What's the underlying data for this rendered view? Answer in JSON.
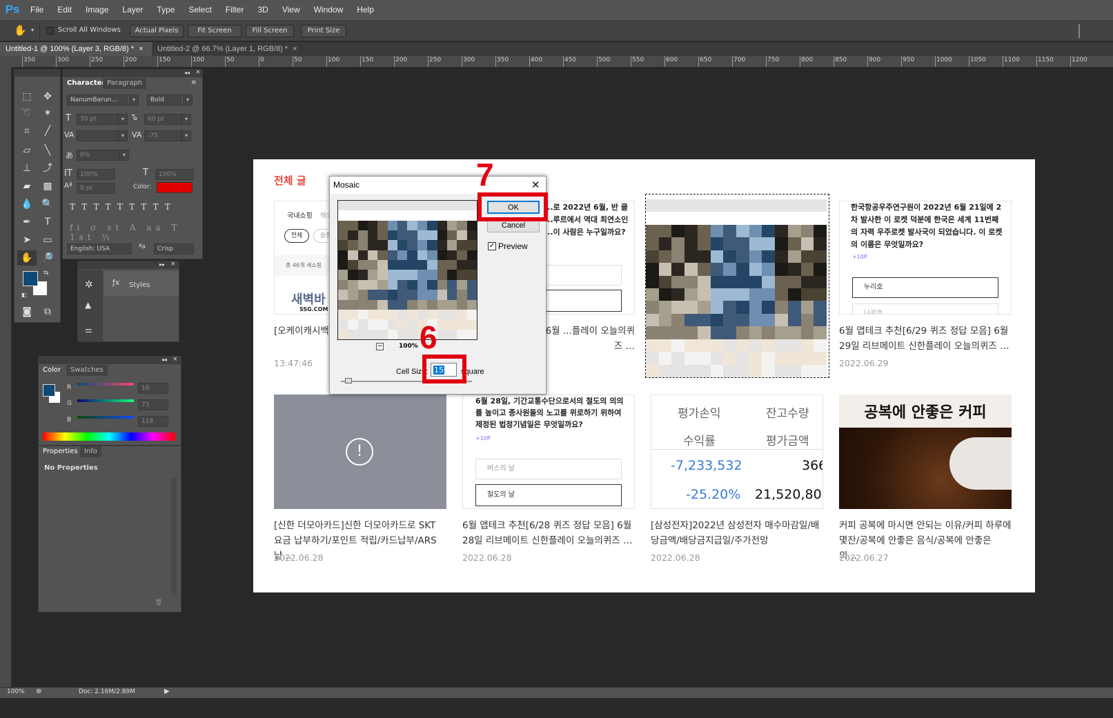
{
  "app": {
    "logo": "Ps"
  },
  "menu": [
    "File",
    "Edit",
    "Image",
    "Layer",
    "Type",
    "Select",
    "Filter",
    "3D",
    "View",
    "Window",
    "Help"
  ],
  "options": {
    "scroll_all": "Scroll All Windows",
    "actual_pixels": "Actual Pixels",
    "fit_screen": "Fit Screen",
    "fill_screen": "Fill Screen",
    "print_size": "Print Size"
  },
  "doc_tabs": [
    {
      "label": "Untitled-1 @ 100% (Layer 3, RGB/8) *",
      "active": true
    },
    {
      "label": "Untitled-2 @ 66.7% (Layer 1, RGB/8) *",
      "active": false
    }
  ],
  "ruler_labels": [
    "350",
    "300",
    "250",
    "200",
    "150",
    "100",
    "50",
    "0",
    "50",
    "100",
    "150",
    "200",
    "250",
    "300",
    "350",
    "400",
    "450",
    "500",
    "550",
    "600",
    "650",
    "700",
    "750",
    "800",
    "850",
    "900",
    "950",
    "1000",
    "1050",
    "1100",
    "1150",
    "1200"
  ],
  "character": {
    "tab_character": "Character",
    "tab_paragraph": "Paragraph",
    "font_family": "NanumBarun...",
    "font_style": "Bold",
    "size": "70 pt",
    "leading": "60 pt",
    "tracking": "-75",
    "scale_pct": "0%",
    "vscale": "100%",
    "hscale": "100%",
    "baseline": "0 pt",
    "color_label": "Color:",
    "color": "#e00000",
    "language": "English: USA",
    "aa_label": "ªa",
    "antialias": "Crisp"
  },
  "styles": {
    "label": "Styles"
  },
  "color_panel": {
    "tab_color": "Color",
    "tab_swatches": "Swatches",
    "r_label": "R",
    "g_label": "G",
    "b_label": "B",
    "r": "16",
    "g": "73",
    "b": "118",
    "fg": "#104976"
  },
  "properties": {
    "tab_properties": "Properties",
    "tab_info": "Info",
    "empty": "No Properties"
  },
  "status": {
    "zoom": "100%",
    "doc": "Doc: 2.16M/2.89M"
  },
  "blog": {
    "heading": "전체 글",
    "cards_row1": [
      {
        "title": "[오케이캐시백 ... 어플 쇼핑적립",
        "date": "13:47:46",
        "thumb_tab1": "국내쇼핑",
        "thumb_tab2": "해외",
        "pill1": "전체",
        "pill2": "숑핑",
        "count": "총 46개 새쇼핑",
        "brand": "새벽바",
        "brand2": "SSG.COM"
      },
      {
        "title": "...) 퀴즈 정답 모음] 6월 ...플레이 오늘의퀴즈 …",
        "quiz": "...로 2022년 6월, 반 클 ...루르에서 역대 최연소인 ...이 사람은 누구일까요?"
      },
      {
        "title": "",
        "date": ""
      },
      {
        "title": "6월 앱테크 추천[6/29 퀴즈 정답 모음] 6월 29일 리브메이트 신한플레이 오늘의퀴즈 …",
        "date": "2022.06.29",
        "quiz": "한국항공우주연구원이 2022년 6월 21일에 2차 발사한 이 로켓 덕분에 한국은 세계 11번째의 자력 우주로켓 발사국이 되었습니다. 이 로켓의 이름은 무엇일까요?",
        "hint": "+10P",
        "opt1": "누리호",
        "opt2": "나로호"
      }
    ],
    "cards_row2": [
      {
        "title": "[신한 더모아카드]신한 더모아카드로 SKT 요금 납부하기/포인트 적립/카드납부/ARS납…",
        "date": "2022.06.28",
        "icon": "!"
      },
      {
        "title": "6월 앱테크 추천[6/28 퀴즈 정답 모음] 6월 28일 리브메이트 신한플레이 오늘의퀴즈 …",
        "date": "2022.06.28",
        "quiz": "6월 28일, 기간교통수단으로서의 철도의 의의를 높이고 종사원들의 노고를 위로하기 위하여 제정된 법정기념일은 무엇일까요?",
        "hint": "+10P",
        "opt1": "버스의 날",
        "opt2": "철도의 날"
      },
      {
        "title": "[삼성전자]2022년 삼성전자 매수마감일/배당금액/배당금지급일/주가전망",
        "date": "2022.06.28",
        "h1": "평가손익",
        "h2": "잔고수량",
        "h3": "수익률",
        "h4": "평가금액",
        "v1": "-7,233,532",
        "v2": "366",
        "v3": "-25.20%",
        "v4": "21,520,800"
      },
      {
        "title": "커피 공복에 마시면 안되는 이유/커피 하루에 몇잔/공복에 안좋은 음식/공복에 안좋은 의…",
        "date": "2022.06.27",
        "banner": "공복에 안좋은 커피"
      }
    ]
  },
  "mosaic_dialog": {
    "title": "Mosaic",
    "ok": "OK",
    "cancel": "Cancel",
    "preview": "Preview",
    "zoom": "100%",
    "cell_size_label": "Cell Size:",
    "cell_size": "15",
    "unit": "square"
  },
  "annotations": {
    "step6": "6",
    "step7": "7",
    "color": "#e00012"
  }
}
